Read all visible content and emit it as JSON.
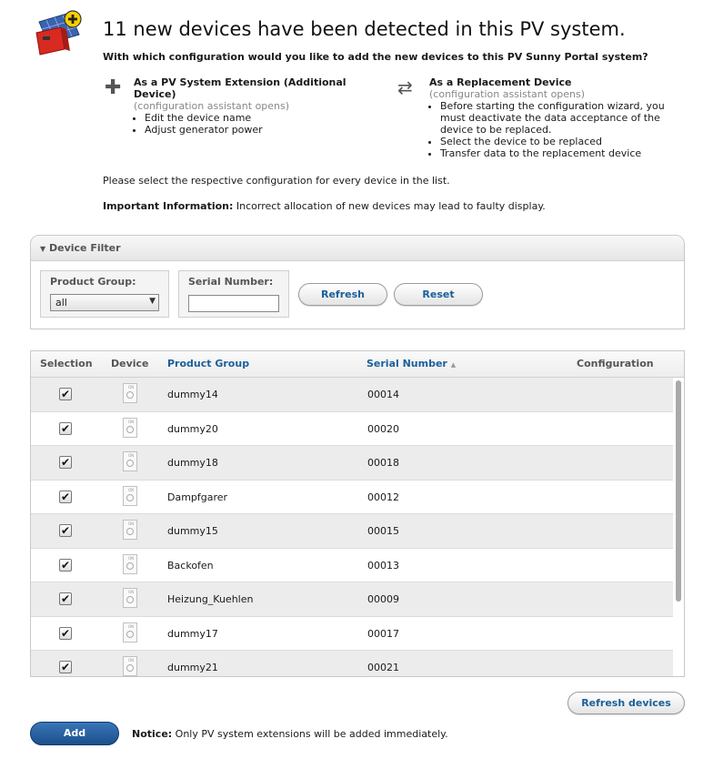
{
  "header": {
    "title": "11 new devices have been detected in this PV system.",
    "question": "With which configuration would you like to add the new devices to this PV Sunny Portal system?"
  },
  "options": {
    "extension": {
      "title_line1": "As a PV System Extension (Additional",
      "title_line2": "Device)",
      "subtitle": "(configuration assistant opens)",
      "bullets": [
        "Edit the device name",
        "Adjust generator power"
      ]
    },
    "replacement": {
      "title": "As a Replacement Device",
      "subtitle": "(configuration assistant opens)",
      "bullets": [
        "Before starting the configuration wizard, you must deactivate the data acceptance of the device to be replaced.",
        "Select the device to be replaced",
        "Transfer data to the replacement device"
      ]
    }
  },
  "info": {
    "select_text": "Please select the respective configuration for every device in the list.",
    "important_label": "Important Information:",
    "important_text": " Incorrect allocation of new devices may lead to faulty display."
  },
  "filter": {
    "header": "Device Filter",
    "product_group_label": "Product Group:",
    "product_group_value": "all",
    "serial_number_label": "Serial Number:",
    "serial_number_value": "",
    "refresh_label": "Refresh",
    "reset_label": "Reset"
  },
  "table": {
    "columns": {
      "selection": "Selection",
      "device": "Device",
      "product_group": "Product Group",
      "serial_number": "Serial Number",
      "configuration": "Configuration"
    },
    "device_icon_text": "ON",
    "rows": [
      {
        "product_group": "dummy14",
        "serial_number": "00014",
        "checked": true
      },
      {
        "product_group": "dummy20",
        "serial_number": "00020",
        "checked": true
      },
      {
        "product_group": "dummy18",
        "serial_number": "00018",
        "checked": true
      },
      {
        "product_group": "Dampfgarer",
        "serial_number": "00012",
        "checked": true
      },
      {
        "product_group": "dummy15",
        "serial_number": "00015",
        "checked": true
      },
      {
        "product_group": "Backofen",
        "serial_number": "00013",
        "checked": true
      },
      {
        "product_group": "Heizung_Kuehlen",
        "serial_number": "00009",
        "checked": true
      },
      {
        "product_group": "dummy17",
        "serial_number": "00017",
        "checked": true
      },
      {
        "product_group": "dummy21",
        "serial_number": "00021",
        "checked": true
      }
    ]
  },
  "footer": {
    "refresh_devices_label": "Refresh devices",
    "add_label": "Add",
    "notice_label": "Notice:",
    "notice_text": " Only PV system extensions will be added immediately."
  },
  "colors": {
    "link_blue": "#1a5f9a",
    "add_button": "#1b4f8c",
    "inverter_red": "#d82a20",
    "badge_yellow": "#f6d000"
  }
}
